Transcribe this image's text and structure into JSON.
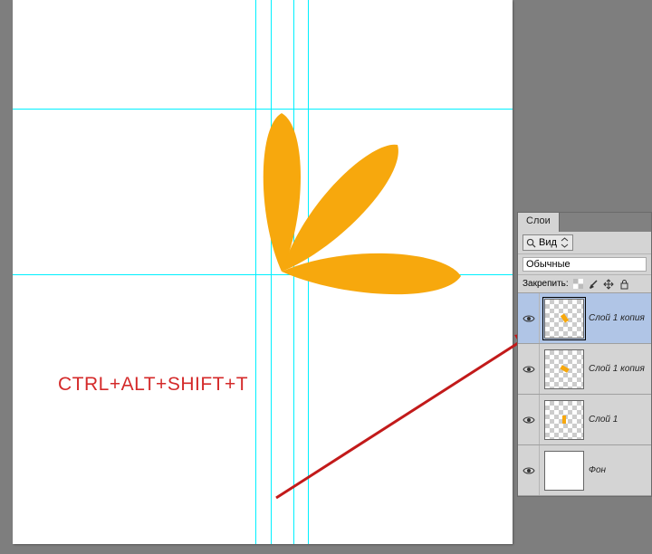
{
  "keyboard_shortcut": "CTRL+ALT+SHIFT+T",
  "panel": {
    "tab": "Слои",
    "view_label": "Вид",
    "blend_value": "Обычные",
    "lock_label": "Закрепить:"
  },
  "layers": [
    {
      "name": "Слой 1 копия"
    },
    {
      "name": "Слой 1 копия"
    },
    {
      "name": "Слой 1"
    },
    {
      "name": "Фон"
    }
  ]
}
